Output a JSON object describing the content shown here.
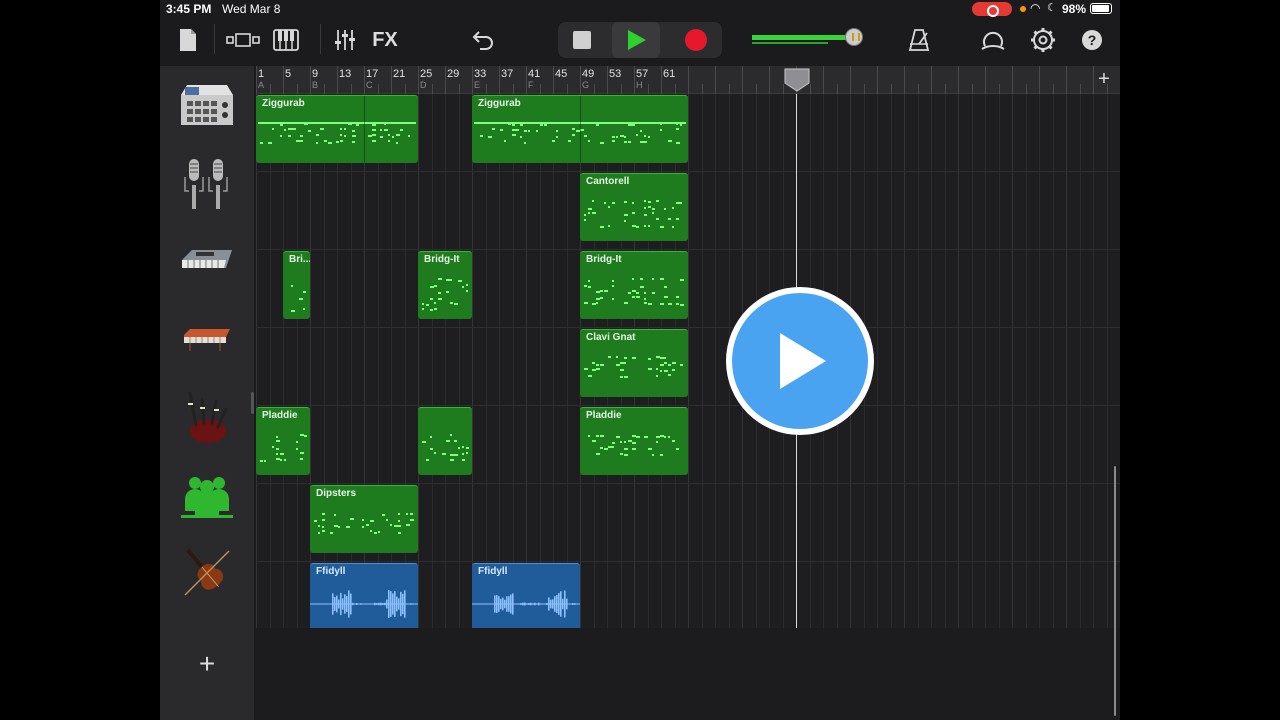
{
  "status_bar": {
    "time": "3:45 PM",
    "date": "Wed Mar 8",
    "battery": "98%"
  },
  "toolbar": {
    "fx_label": "FX",
    "icons": [
      "document-icon",
      "track-view-icon",
      "keyboard-icon",
      "mixer-icon",
      "undo-icon",
      "stop-icon",
      "play-icon",
      "record-icon",
      "master-volume-slider",
      "metronome-icon",
      "loop-browser-icon",
      "settings-icon",
      "help-icon"
    ],
    "master_volume": 0.95
  },
  "ruler": {
    "bars": [
      "1",
      "5",
      "9",
      "13",
      "17",
      "21",
      "25",
      "29",
      "33",
      "37",
      "41",
      "45",
      "49",
      "53",
      "57",
      "61"
    ],
    "sections": [
      "A",
      "B",
      "C",
      "D",
      "E",
      "F",
      "G",
      "H"
    ],
    "add_section": "+"
  },
  "tracks": [
    {
      "instrument": "drum-machine-icon",
      "regions": [
        {
          "name": "Ziggurab",
          "kind": "midi"
        },
        {
          "name": "Ziggurab",
          "kind": "midi"
        }
      ]
    },
    {
      "instrument": "microphones-icon",
      "regions": [
        {
          "name": "Cantorell",
          "kind": "midi"
        }
      ]
    },
    {
      "instrument": "synth-keyboard-icon",
      "regions": [
        {
          "name": "Bri...-It",
          "kind": "midi"
        },
        {
          "name": "Bridg-It",
          "kind": "midi"
        },
        {
          "name": "Bridg-It",
          "kind": "midi"
        }
      ]
    },
    {
      "instrument": "clavinet-icon",
      "regions": [
        {
          "name": "Clavi Gnat",
          "kind": "midi"
        }
      ]
    },
    {
      "instrument": "bagpipes-icon",
      "regions": [
        {
          "name": "Pladdie",
          "kind": "midi"
        },
        {
          "name": "",
          "kind": "midi"
        },
        {
          "name": "Pladdie",
          "kind": "midi"
        }
      ]
    },
    {
      "instrument": "ensemble-icon",
      "regions": [
        {
          "name": "Dipsters",
          "kind": "midi"
        }
      ]
    },
    {
      "instrument": "violin-icon",
      "regions": [
        {
          "name": "Ffidyll",
          "kind": "audio"
        },
        {
          "name": "Ffidyll",
          "kind": "audio"
        }
      ]
    }
  ],
  "add_track": "+",
  "colors": {
    "midi_region": "#1e7b1e",
    "audio_region": "#205b9a",
    "record": "#e5192b",
    "play": "#2fd12f",
    "overlay": "#4aa3f0"
  }
}
